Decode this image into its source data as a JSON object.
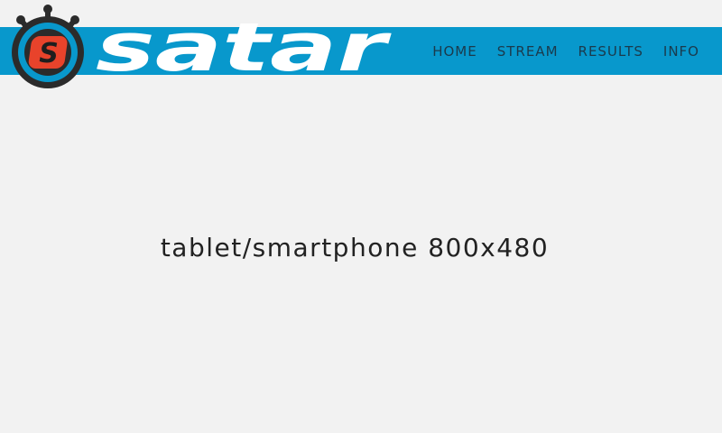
{
  "colors": {
    "header_bar": "#0898cc",
    "background": "#f2f2f2",
    "logo_ring": "#2b2b2b",
    "logo_inner_ring": "#0898cc",
    "logo_badge": "#e8432b",
    "nav_text": "#1b3a4c"
  },
  "logo": {
    "icon": "stopwatch-s-icon",
    "badge_letter": "S",
    "wordmark": "satar"
  },
  "nav": {
    "items": [
      {
        "label": "HOME"
      },
      {
        "label": "STREAM"
      },
      {
        "label": "RESULTS"
      },
      {
        "label": "INFO"
      }
    ]
  },
  "main": {
    "message": "tablet/smartphone 800x480"
  }
}
